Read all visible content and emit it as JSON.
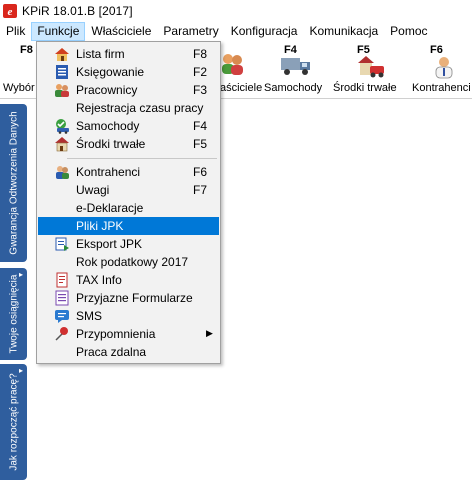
{
  "window": {
    "title": "KPiR 18.01.B [2017]"
  },
  "menubar": {
    "items": [
      "Plik",
      "Funkcje",
      "Właściciele",
      "Parametry",
      "Konfiguracja",
      "Komunikacja",
      "Pomoc"
    ]
  },
  "toolbar": {
    "buttons": [
      {
        "key": "F8",
        "label": "Wybór f",
        "icon": "company-select-icon"
      },
      {
        "key": "",
        "label": "aściciele",
        "icon": "owners-icon"
      },
      {
        "key": "F4",
        "label": "Samochody",
        "icon": "truck-icon"
      },
      {
        "key": "F5",
        "label": "Środki trwałe",
        "icon": "fixed-assets-icon"
      },
      {
        "key": "F6",
        "label": "Kontrahenci",
        "icon": "contractors-icon"
      }
    ]
  },
  "side_tabs": [
    {
      "label": "Gwarancja Odtworzenia Danych"
    },
    {
      "label": "Twoje osiągnięcia"
    },
    {
      "label": "Jak rozpocząć pracę?"
    }
  ],
  "dropdown": {
    "items": [
      {
        "label": "Lista firm",
        "shortcut": "F8",
        "icon": "house-icon"
      },
      {
        "label": "Księgowanie",
        "shortcut": "F2",
        "icon": "ledger-icon"
      },
      {
        "label": "Pracownicy",
        "shortcut": "F3",
        "icon": "employees-icon"
      },
      {
        "label": "Rejestracja czasu pracy",
        "shortcut": "",
        "icon": ""
      },
      {
        "label": "Samochody",
        "shortcut": "F4",
        "icon": "car-icon"
      },
      {
        "label": "Środki trwałe",
        "shortcut": "F5",
        "icon": "building-icon"
      },
      {
        "label": "Kontrahenci",
        "shortcut": "F6",
        "icon": "contractors-icon"
      },
      {
        "label": "Uwagi",
        "shortcut": "F7",
        "icon": ""
      },
      {
        "label": "e-Deklaracje",
        "shortcut": "",
        "icon": ""
      },
      {
        "label": "Pliki JPK",
        "shortcut": "",
        "icon": ""
      },
      {
        "label": "Eksport JPK",
        "shortcut": "",
        "icon": "export-icon"
      },
      {
        "label": "Rok podatkowy 2017",
        "shortcut": "",
        "icon": ""
      },
      {
        "label": "TAX Info",
        "shortcut": "",
        "icon": "document-icon"
      },
      {
        "label": "Przyjazne Formularze",
        "shortcut": "",
        "icon": "form-icon"
      },
      {
        "label": "SMS",
        "shortcut": "",
        "icon": "sms-icon"
      },
      {
        "label": "Przypomnienia",
        "shortcut": "",
        "icon": "pin-icon",
        "submenu": true
      },
      {
        "label": "Praca zdalna",
        "shortcut": "",
        "icon": ""
      }
    ]
  },
  "colors": {
    "highlight": "#0078d7",
    "menu_active": "#cce8ff",
    "side_tab": "#2f5e9e",
    "logo_red": "#d9261c"
  }
}
